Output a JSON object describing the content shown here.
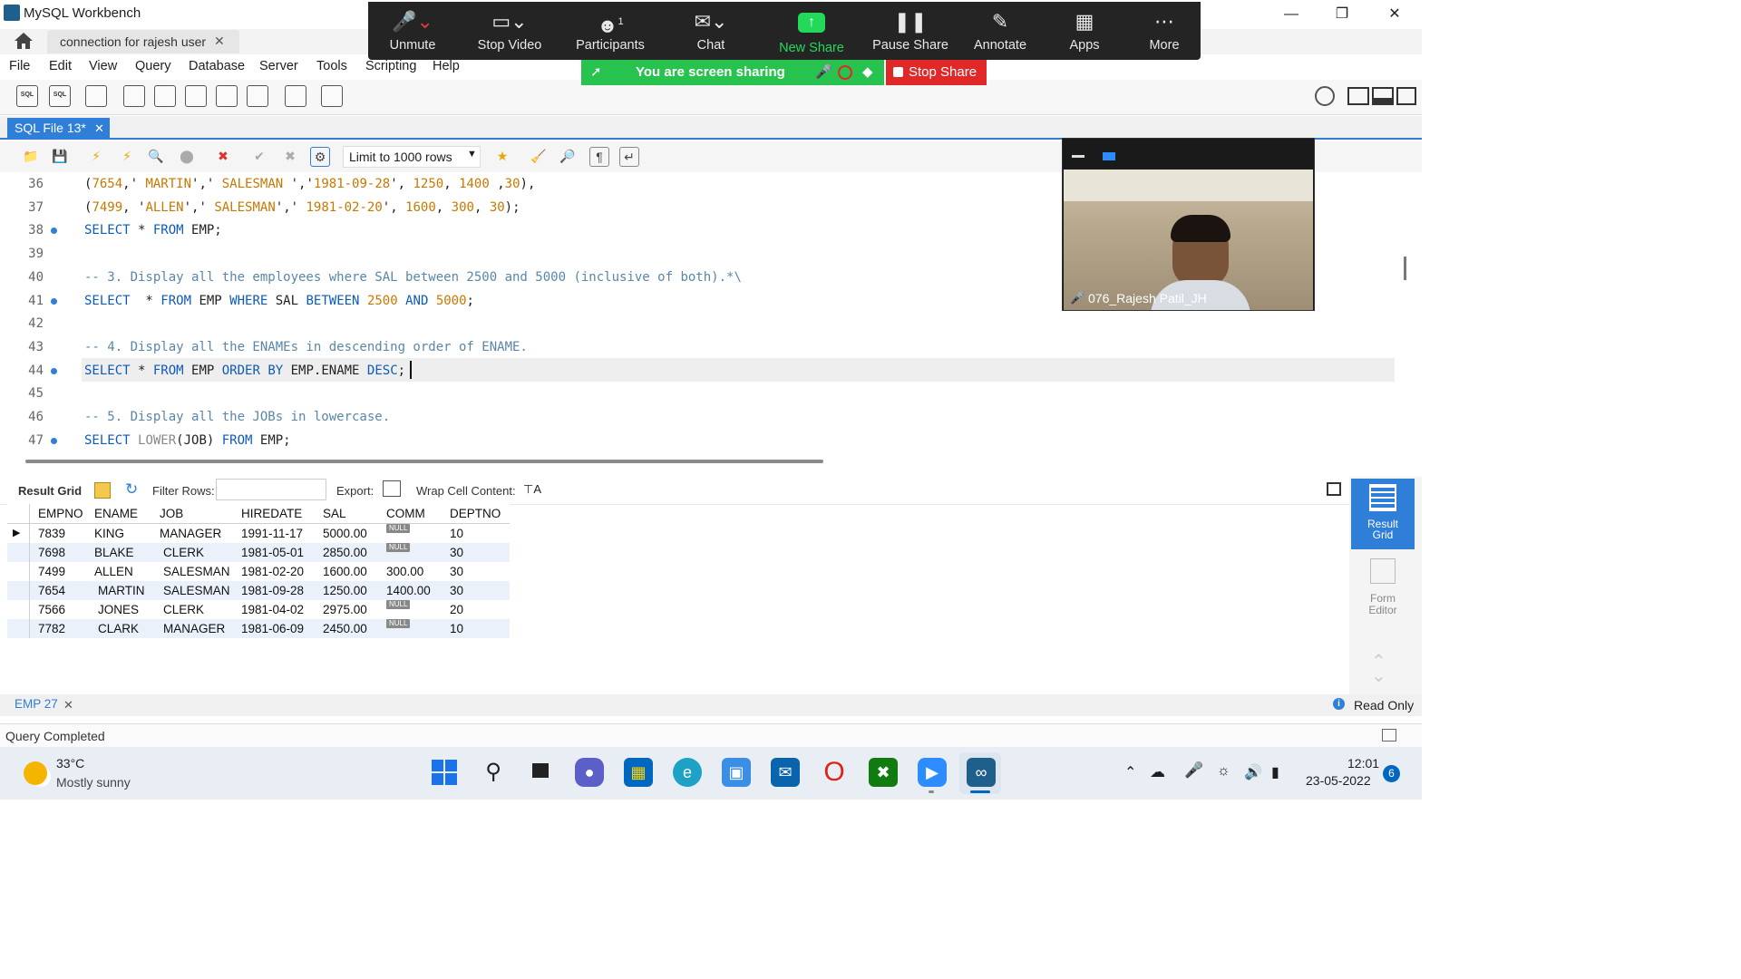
{
  "app": {
    "title": "MySQL Workbench",
    "connection_tab": "connection for rajesh user",
    "menu": [
      "File",
      "Edit",
      "View",
      "Query",
      "Database",
      "Server",
      "Tools",
      "Scripting",
      "Help"
    ]
  },
  "zoom": {
    "buttons": [
      {
        "label": "Unmute",
        "icon": "mic-muted-icon"
      },
      {
        "label": "Stop Video",
        "icon": "camera-icon"
      },
      {
        "label": "Participants",
        "icon": "participants-icon",
        "count": "1"
      },
      {
        "label": "Chat",
        "icon": "chat-icon"
      },
      {
        "label": "New Share",
        "icon": "share-up-icon"
      },
      {
        "label": "Pause Share",
        "icon": "pause-icon"
      },
      {
        "label": "Annotate",
        "icon": "pencil-icon"
      },
      {
        "label": "Apps",
        "icon": "apps-icon"
      },
      {
        "label": "More",
        "icon": "ellipsis-icon"
      }
    ],
    "banner": "You are screen sharing",
    "stop_share": "Stop Share",
    "video_name": "076_Rajesh Patil_JH",
    "brand_green": "#23d959",
    "stop_red": "#e02828"
  },
  "editor": {
    "tab_label": "SQL File 13*",
    "limit_label": "Limit to 1000 rows",
    "lines": [
      {
        "no": "36",
        "bp": false,
        "segs": [
          [
            "plain",
            "("
          ],
          [
            "num",
            "7654"
          ],
          [
            "plain",
            ",' "
          ],
          [
            "str",
            "MARTIN"
          ],
          [
            "plain",
            "',' "
          ],
          [
            "str",
            "SALESMAN "
          ],
          [
            "plain",
            "','"
          ],
          [
            "str",
            "1981-09-28"
          ],
          [
            "plain",
            "', "
          ],
          [
            "num",
            "1250"
          ],
          [
            "plain",
            ", "
          ],
          [
            "num",
            "1400"
          ],
          [
            "plain",
            " ,"
          ],
          [
            "num",
            "30"
          ],
          [
            "plain",
            "),"
          ]
        ]
      },
      {
        "no": "37",
        "bp": false,
        "segs": [
          [
            "plain",
            "("
          ],
          [
            "num",
            "7499"
          ],
          [
            "plain",
            ", '"
          ],
          [
            "str",
            "ALLEN"
          ],
          [
            "plain",
            "',' "
          ],
          [
            "str",
            "SALESMAN"
          ],
          [
            "plain",
            "',' "
          ],
          [
            "str",
            "1981-02-20"
          ],
          [
            "plain",
            "', "
          ],
          [
            "num",
            "1600"
          ],
          [
            "plain",
            ", "
          ],
          [
            "num",
            "300"
          ],
          [
            "plain",
            ", "
          ],
          [
            "num",
            "30"
          ],
          [
            "plain",
            ");"
          ]
        ]
      },
      {
        "no": "38",
        "bp": true,
        "segs": [
          [
            "kw",
            "SELECT"
          ],
          [
            "plain",
            " * "
          ],
          [
            "kw",
            "FROM"
          ],
          [
            "plain",
            " EMP;"
          ]
        ]
      },
      {
        "no": "39",
        "bp": false,
        "segs": []
      },
      {
        "no": "40",
        "bp": false,
        "segs": [
          [
            "cmt",
            "-- 3. Display all the employees where SAL between 2500 and 5000 (inclusive of both).*\\"
          ]
        ]
      },
      {
        "no": "41",
        "bp": true,
        "segs": [
          [
            "kw",
            "SELECT"
          ],
          [
            "plain",
            "  * "
          ],
          [
            "kw",
            "FROM"
          ],
          [
            "plain",
            " EMP "
          ],
          [
            "kw",
            "WHERE"
          ],
          [
            "plain",
            " SAL "
          ],
          [
            "kw",
            "BETWEEN"
          ],
          [
            "plain",
            " "
          ],
          [
            "num",
            "2500"
          ],
          [
            "plain",
            " "
          ],
          [
            "kw",
            "AND"
          ],
          [
            "plain",
            " "
          ],
          [
            "num",
            "5000"
          ],
          [
            "plain",
            ";"
          ]
        ]
      },
      {
        "no": "42",
        "bp": false,
        "segs": []
      },
      {
        "no": "43",
        "bp": false,
        "segs": [
          [
            "cmt",
            "-- 4. Display all the ENAMEs in descending order of ENAME."
          ]
        ]
      },
      {
        "no": "44",
        "bp": true,
        "segs": [
          [
            "kw",
            "SELECT"
          ],
          [
            "plain",
            " * "
          ],
          [
            "kw",
            "FROM"
          ],
          [
            "plain",
            " EMP "
          ],
          [
            "kw",
            "ORDER BY"
          ],
          [
            "plain",
            " EMP.ENAME "
          ],
          [
            "kw",
            "DESC"
          ],
          [
            "plain",
            ";"
          ]
        ]
      },
      {
        "no": "45",
        "bp": false,
        "segs": []
      },
      {
        "no": "46",
        "bp": false,
        "segs": [
          [
            "cmt",
            "-- 5. Display all the JOBs in lowercase."
          ]
        ]
      },
      {
        "no": "47",
        "bp": true,
        "segs": [
          [
            "kw",
            "SELECT"
          ],
          [
            "plain",
            " "
          ],
          [
            "fn",
            "LOWER"
          ],
          [
            "plain",
            "(JOB) "
          ],
          [
            "kw",
            "FROM"
          ],
          [
            "plain",
            " EMP;"
          ]
        ]
      }
    ]
  },
  "result": {
    "toolbar": {
      "result_grid": "Result Grid",
      "filter_rows": "Filter Rows:",
      "export": "Export:",
      "wrap": "Wrap Cell Content:"
    },
    "columns": [
      "EMPNO",
      "ENAME",
      "JOB",
      "HIREDATE",
      "SAL",
      "COMM",
      "DEPTNO"
    ],
    "rows": [
      [
        "7839",
        "KING",
        "MANAGER",
        "1991-11-17",
        "5000.00",
        "NULL",
        "10"
      ],
      [
        "7698",
        "BLAKE",
        "CLERK",
        "1981-05-01",
        "2850.00",
        "NULL",
        "30"
      ],
      [
        "7499",
        "ALLEN",
        "SALESMAN",
        "1981-02-20",
        "1600.00",
        "300.00",
        "30"
      ],
      [
        "7654",
        "MARTIN",
        "SALESMAN",
        "1981-09-28",
        "1250.00",
        "1400.00",
        "30"
      ],
      [
        "7566",
        "JONES",
        "CLERK",
        "1981-04-02",
        "2975.00",
        "NULL",
        "20"
      ],
      [
        "7782",
        "CLARK",
        "MANAGER",
        "1981-06-09",
        "2450.00",
        "NULL",
        "10"
      ]
    ],
    "side": {
      "result_grid": "Result\nGrid",
      "form_editor": "Form\nEditor"
    },
    "bottom_tab": "EMP 27",
    "read_only": "Read Only",
    "status": "Query Completed"
  },
  "taskbar": {
    "weather_temp": "33°C",
    "weather_desc": "Mostly sunny",
    "time": "12:01",
    "date": "23-05-2022",
    "notif_count": "6"
  }
}
